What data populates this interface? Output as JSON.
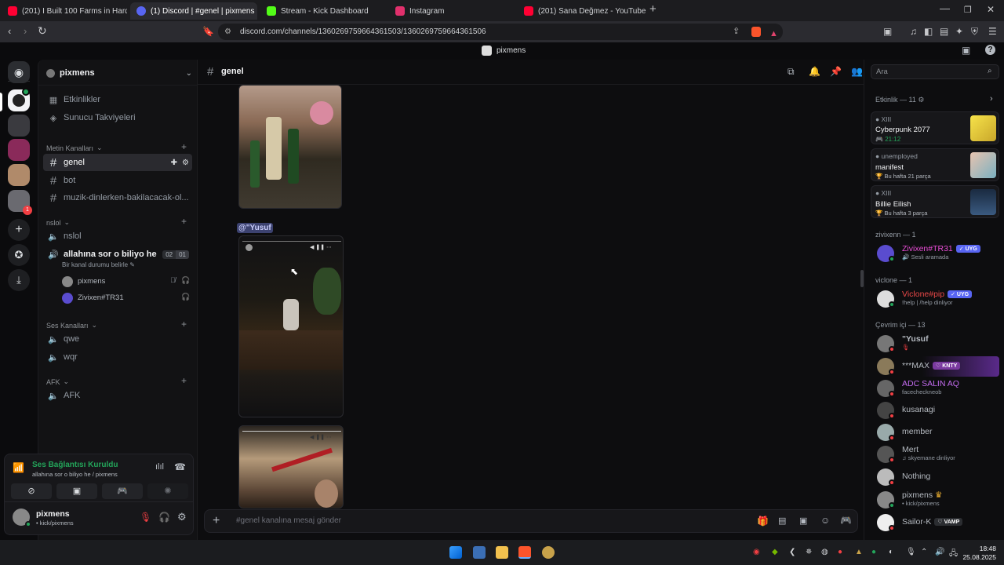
{
  "tabs": [
    {
      "title": "(201) I Built 100 Farms in Hardcore M",
      "icon_color": "#ff0033"
    },
    {
      "title": "(1) Discord | #genel | pixmens",
      "icon_color": "#5865f2"
    },
    {
      "title": "Stream - Kick Dashboard",
      "icon_color": "#53fc18"
    },
    {
      "title": "Instagram",
      "icon_color": "#e1306c"
    },
    {
      "title": "(201) Sana Değmez - YouTube",
      "icon_color": "#ff0033"
    }
  ],
  "address": {
    "url": "discord.com/channels/1360269759664361503/1360269759664361506"
  },
  "discord_title": "pixmens",
  "server": {
    "name": "pixmens"
  },
  "channel_list": {
    "top_items": [
      "Etkinlikler",
      "Sunucu Takviyeleri"
    ],
    "text_category": "Metin Kanalları",
    "text_channels": [
      "genel",
      "bot",
      "muzik-dinlerken-bakilacacak-ol..."
    ],
    "voice_category": "nslol",
    "voice_channels": [
      "nslol",
      "allahına sor o biliyo he"
    ],
    "voice_status": "Bir kanal durumu belirle",
    "voice_counts": [
      "02",
      "01"
    ],
    "voice_users": [
      "pixmens",
      "Zivixen#TR31"
    ],
    "ses_category": "Ses Kanalları",
    "ses_channels": [
      "qwe",
      "wqr"
    ],
    "afk_category": "AFK",
    "afk_channels": [
      "AFK"
    ]
  },
  "voice_panel": {
    "status": "Ses Bağlantısı Kuruldu",
    "channel": "allahına sor o biliyo he / pixmens"
  },
  "user_panel": {
    "name": "pixmens",
    "sub": "• kick/pixmens"
  },
  "main": {
    "channel_name": "genel",
    "search_placeholder": "Ara",
    "mention": "@\"Yusuf",
    "composer_placeholder": "#genel kanalına mesaj gönder"
  },
  "activity": {
    "header": "Etkinlik — 11",
    "cards": [
      {
        "user": "XIII",
        "title": "Cyberpunk 2077",
        "sub": "21:12"
      },
      {
        "user": "unemployed",
        "title": "manifest",
        "sub": "Bu hafta 21 parça"
      },
      {
        "user": "XIII",
        "title": "Billie Eilish",
        "sub": "Bu hafta 3 parça"
      }
    ]
  },
  "member_groups": [
    {
      "label": "zivixenn — 1",
      "members": [
        {
          "name": "Zivixen#TR31",
          "sub": "Sesli aramada",
          "badge": "✓ UYG",
          "color": "#e94dd6"
        }
      ]
    },
    {
      "label": "viclone — 1",
      "members": [
        {
          "name": "Viclone#pip",
          "sub": "!help | /help dinliyor",
          "badge": "✓ UYG",
          "color": "#e94848"
        }
      ]
    },
    {
      "label": "Çevrim içi — 13",
      "members": [
        {
          "name": "\"Yusuf",
          "sub": "",
          "badge": "",
          "color": "#b5bac1"
        },
        {
          "name": "***MAX",
          "sub": "",
          "badge": "♡ KNTY",
          "color": "#b5bac1"
        },
        {
          "name": "ADC SALIN AQ",
          "sub": "facecheckneob",
          "badge": "",
          "color": "#c46cf0"
        },
        {
          "name": "kusanagi",
          "sub": "",
          "badge": "",
          "color": "#b5bac1"
        },
        {
          "name": "member",
          "sub": "",
          "badge": "",
          "color": "#b5bac1"
        },
        {
          "name": "Mert",
          "sub": "skyemane dinliyor",
          "badge": "",
          "color": "#b5bac1"
        },
        {
          "name": "Nothing",
          "sub": "",
          "badge": "",
          "color": "#b5bac1"
        },
        {
          "name": "pixmens",
          "sub": "• kick/pixmens",
          "badge": "",
          "color": "#b5bac1"
        },
        {
          "name": "Sailor-K",
          "sub": "",
          "badge": "♡ VAMP",
          "color": "#b5bac1"
        }
      ]
    }
  ],
  "taskbar": {
    "time": "18:48",
    "date": "25.08.2025"
  },
  "colors": {
    "accent": "#5865f2",
    "online": "#23a55a",
    "dnd": "#f23f43"
  }
}
